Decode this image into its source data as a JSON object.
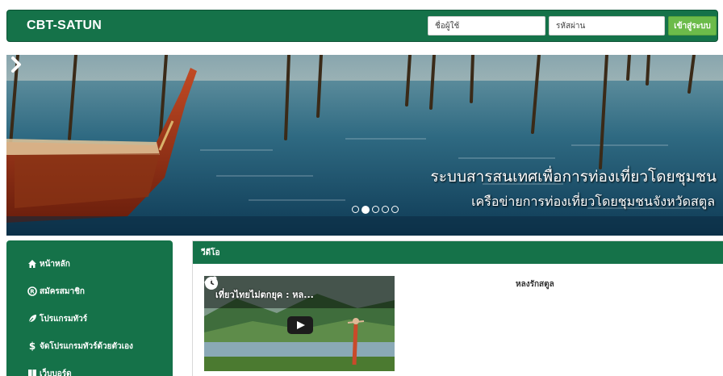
{
  "navbar": {
    "brand": "CBT-SATUN",
    "username_placeholder": "ชื่อผู้ใช้",
    "password_placeholder": "รหัสผ่าน",
    "login_label": "เข้าสู่ระบบ"
  },
  "carousel": {
    "title": "ระบบสารสนเทศเพื่อการท่องเที่ยวโดยชุมชน",
    "subtitle": "เครือข่ายการท่องเที่ยวโดยชุมชนจังหวัดสตูล",
    "slide_count": 5,
    "active_index": 1
  },
  "sidebar": {
    "items": [
      {
        "label": "หน้าหลัก",
        "icon": "home-icon"
      },
      {
        "label": "สมัครสมาชิก",
        "icon": "register-icon"
      },
      {
        "label": "โปรแกรมทัวร์",
        "icon": "leaf-icon"
      },
      {
        "label": "จัดโปรแกรมทัวร์ด้วยตัวเอง",
        "icon": "dollar-icon"
      },
      {
        "label": "เว็บบอร์ด",
        "icon": "board-icon"
      }
    ]
  },
  "video_panel": {
    "heading": "วีดีโอ",
    "video_title": "เที่ยวไทยไม่ตกยุค : หล...",
    "description": "หลงรักสตูล"
  },
  "colors": {
    "primary_green": "#157249",
    "login_button": "#6cbb4a"
  }
}
